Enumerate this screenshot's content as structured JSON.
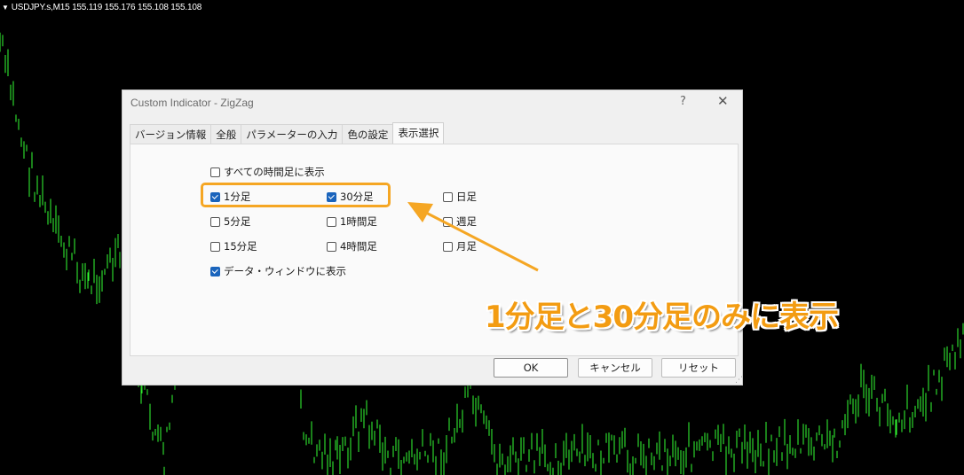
{
  "chart": {
    "symbol_info": "USDJPY.s,M15  155.119 155.176 155.108 155.108",
    "candle_color": "#33ff33",
    "background": "#000000"
  },
  "dialog": {
    "title": "Custom Indicator - ZigZag",
    "help_label": "?",
    "close_label": "✕",
    "tabs": [
      {
        "label": "バージョン情報",
        "active": false
      },
      {
        "label": "全般",
        "active": false
      },
      {
        "label": "パラメーターの入力",
        "active": false
      },
      {
        "label": "色の設定",
        "active": false
      },
      {
        "label": "表示選択",
        "active": true
      }
    ],
    "all_timeframes": {
      "label": "すべての時間足に表示",
      "checked": false
    },
    "timeframes": [
      {
        "label": "1分足",
        "checked": true
      },
      {
        "label": "30分足",
        "checked": true
      },
      {
        "label": "日足",
        "checked": false
      },
      {
        "label": "5分足",
        "checked": false
      },
      {
        "label": "1時間足",
        "checked": false
      },
      {
        "label": "週足",
        "checked": false
      },
      {
        "label": "15分足",
        "checked": false
      },
      {
        "label": "4時間足",
        "checked": false
      },
      {
        "label": "月足",
        "checked": false
      }
    ],
    "data_window": {
      "label": "データ・ウィンドウに表示",
      "checked": true
    },
    "buttons": {
      "ok": "OK",
      "cancel": "キャンセル",
      "reset": "リセット"
    }
  },
  "annotation": {
    "text": "1分足と30分足のみに表示",
    "color": "#f39c12"
  }
}
